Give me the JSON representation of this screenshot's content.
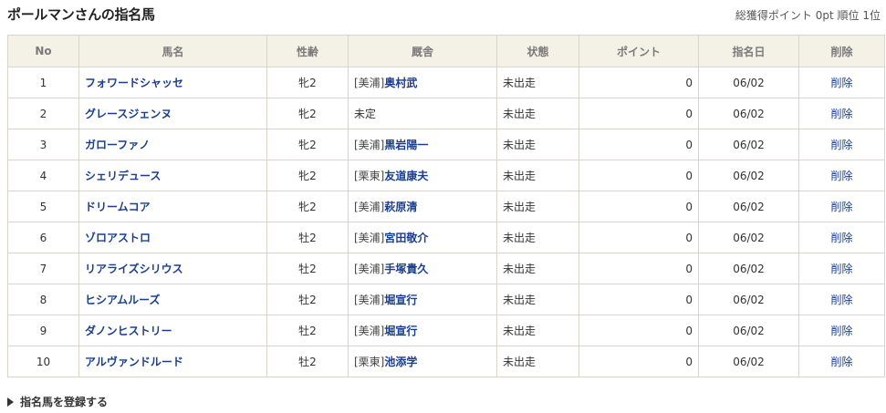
{
  "page_title": "ポールマンさんの指名馬",
  "summary": {
    "points_label": "総獲得ポイント",
    "points_value": "0pt",
    "rank_label": "順位",
    "rank_value": "1位"
  },
  "table": {
    "headers": [
      "No",
      "馬名",
      "性齢",
      "厩舎",
      "状態",
      "ポイント",
      "指名日",
      "削除"
    ],
    "rows": [
      {
        "no": "1",
        "name": "フォワードシャッセ",
        "sex_age": "牝2",
        "region": "[美浦]",
        "trainer": "奥村武",
        "status": "未出走",
        "points": "0",
        "date": "06/02",
        "delete": "削除"
      },
      {
        "no": "2",
        "name": "グレースジェンヌ",
        "sex_age": "牝2",
        "region": "",
        "trainer": "",
        "stable_text": "未定",
        "status": "未出走",
        "points": "0",
        "date": "06/02",
        "delete": "削除"
      },
      {
        "no": "3",
        "name": "ガローファノ",
        "sex_age": "牝2",
        "region": "[美浦]",
        "trainer": "黒岩陽一",
        "status": "未出走",
        "points": "0",
        "date": "06/02",
        "delete": "削除"
      },
      {
        "no": "4",
        "name": "シェリデュース",
        "sex_age": "牝2",
        "region": "[栗東]",
        "trainer": "友道康夫",
        "status": "未出走",
        "points": "0",
        "date": "06/02",
        "delete": "削除"
      },
      {
        "no": "5",
        "name": "ドリームコア",
        "sex_age": "牝2",
        "region": "[美浦]",
        "trainer": "萩原清",
        "status": "未出走",
        "points": "0",
        "date": "06/02",
        "delete": "削除"
      },
      {
        "no": "6",
        "name": "ゾロアストロ",
        "sex_age": "牡2",
        "region": "[美浦]",
        "trainer": "宮田敬介",
        "status": "未出走",
        "points": "0",
        "date": "06/02",
        "delete": "削除"
      },
      {
        "no": "7",
        "name": "リアライズシリウス",
        "sex_age": "牡2",
        "region": "[美浦]",
        "trainer": "手塚貴久",
        "status": "未出走",
        "points": "0",
        "date": "06/02",
        "delete": "削除"
      },
      {
        "no": "8",
        "name": "ヒシアムルーズ",
        "sex_age": "牡2",
        "region": "[美浦]",
        "trainer": "堀宣行",
        "status": "未出走",
        "points": "0",
        "date": "06/02",
        "delete": "削除"
      },
      {
        "no": "9",
        "name": "ダノンヒストリー",
        "sex_age": "牡2",
        "region": "[美浦]",
        "trainer": "堀宣行",
        "status": "未出走",
        "points": "0",
        "date": "06/02",
        "delete": "削除"
      },
      {
        "no": "10",
        "name": "アルヴァンドルード",
        "sex_age": "牡2",
        "region": "[栗東]",
        "trainer": "池添学",
        "status": "未出走",
        "points": "0",
        "date": "06/02",
        "delete": "削除"
      }
    ]
  },
  "footer": {
    "register_link": "指名馬を登録する",
    "icon": "triangle-right-icon"
  },
  "colors": {
    "link": "#1a3e8f",
    "header_bg": "#f4f1e6",
    "border": "#d9d5c9"
  }
}
